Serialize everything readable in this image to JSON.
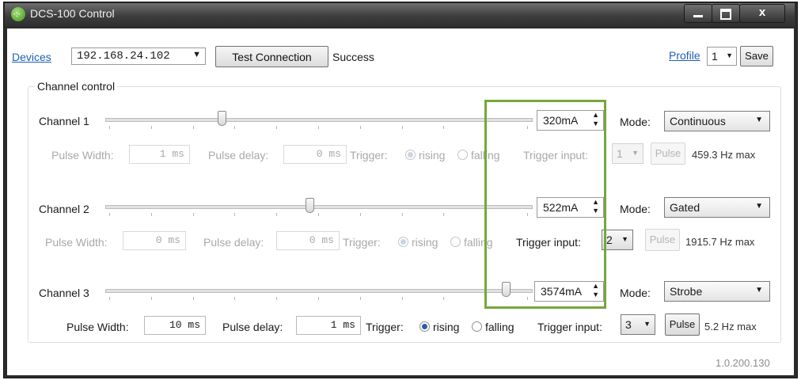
{
  "window": {
    "title": "DCS-100 Control",
    "close_glyph": "x",
    "accent": "#74a839"
  },
  "toolbar": {
    "devices_link": "Devices",
    "device_ip": "192.168.24.102",
    "test_button": "Test Connection",
    "status": "Success",
    "profile_link": "Profile",
    "profile_value": "1",
    "save_button": "Save"
  },
  "group_title": "Channel control",
  "labels": {
    "pulse_width": "Pulse Width:",
    "pulse_delay": "Pulse delay:",
    "trigger": "Trigger:",
    "rising": "rising",
    "falling": "falling",
    "trigger_input": "Trigger input:",
    "mode": "Mode:",
    "pulse": "Pulse"
  },
  "channels": [
    {
      "name": "Channel 1",
      "slider_level": 0.27,
      "current": "320mA",
      "mode": "Continuous",
      "pulse_width": "1 ms",
      "pulse_delay": "0 ms",
      "trigger_edge": "rising",
      "trigger_input": "1",
      "max_rate": "459.3 Hz max",
      "pulse_enabled": false,
      "trigger_input_enabled": false
    },
    {
      "name": "Channel 2",
      "slider_level": 0.48,
      "current": "522mA",
      "mode": "Gated",
      "pulse_width": "0 ms",
      "pulse_delay": "0 ms",
      "trigger_edge": "rising",
      "trigger_input": "2",
      "max_rate": "1915.7 Hz max",
      "pulse_enabled": false,
      "trigger_input_enabled": true
    },
    {
      "name": "Channel 3",
      "slider_level": 0.95,
      "current": "3574mA",
      "mode": "Strobe",
      "pulse_width": "10 ms",
      "pulse_delay": "1 ms",
      "trigger_edge": "rising",
      "trigger_input": "3",
      "max_rate": "5.2 Hz max",
      "pulse_enabled": true,
      "trigger_input_enabled": true
    }
  ],
  "version": "1.0.200.130"
}
